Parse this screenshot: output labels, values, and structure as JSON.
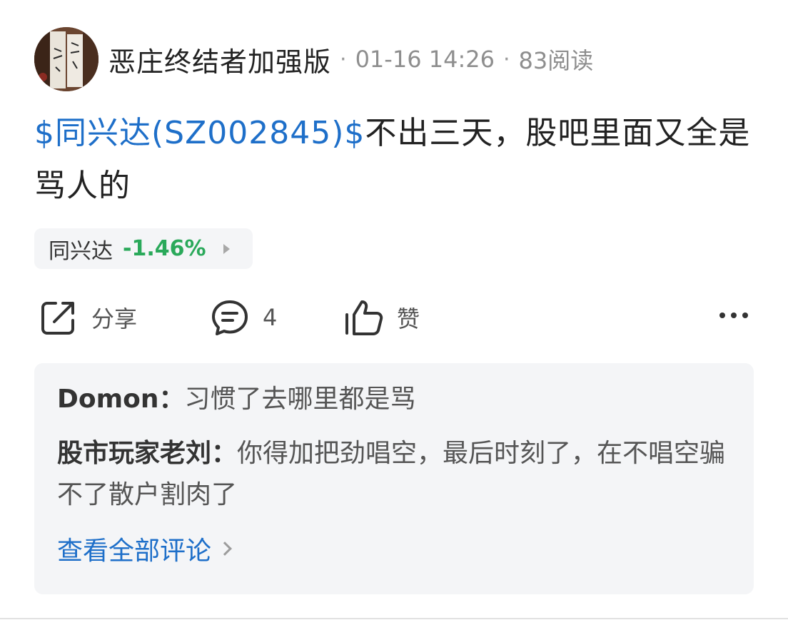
{
  "header": {
    "author": "恶庄终结者加强版",
    "separator": "·",
    "time": "01-16 14:26",
    "reads": "83阅读"
  },
  "post": {
    "stock_link": "$同兴达(SZ002845)$",
    "text": "不出三天，股吧里面又全是骂人的"
  },
  "stock_chip": {
    "name": "同兴达",
    "change": "-1.46%",
    "change_color": "#2aa95a"
  },
  "actions": {
    "share_label": "分享",
    "comment_count": "4",
    "like_label": "赞",
    "icons": [
      "share-icon",
      "comment-icon",
      "thumbs-up-icon",
      "more-icon"
    ]
  },
  "comments": [
    {
      "user": "Domon",
      "sep": "：",
      "text": "习惯了去哪里都是骂"
    },
    {
      "user": "股市玩家老刘",
      "sep": "：",
      "text": "你得加把劲唱空，最后时刻了，在不唱空骗不了散户割肉了"
    }
  ],
  "view_all": "查看全部评论",
  "colors": {
    "link": "#1e6fc9",
    "down": "#2aa95a",
    "panel": "#f4f5f7"
  }
}
